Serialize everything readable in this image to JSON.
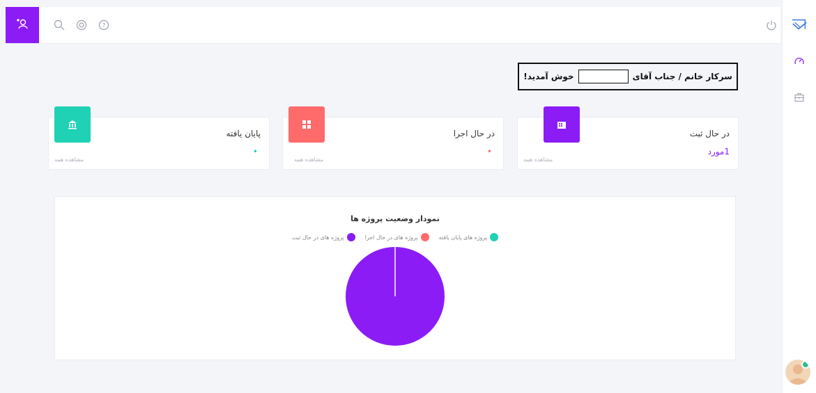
{
  "header": {
    "icons": [
      "add-user-icon",
      "search-icon",
      "support-icon",
      "help-icon",
      "power-icon"
    ]
  },
  "welcome": {
    "text": "سرکار خانم / جناب آقای",
    "suffix": "خوش آمدید!"
  },
  "cards": [
    {
      "title": "در حال ثبت",
      "value": "1مورد",
      "link": "مشاهده همه",
      "color": "#8b1cf6",
      "icon": "building-icon",
      "value_color": "#8b1cf6"
    },
    {
      "title": "در حال اجرا",
      "value": "•",
      "link": "مشاهده همه",
      "color": "#ff6b6b",
      "icon": "grid-icon",
      "value_color": "#ff6b6b"
    },
    {
      "title": "پایان یافته",
      "value": "•",
      "link": "مشاهده همه",
      "color": "#1fd1b5",
      "icon": "bank-icon",
      "value_color": "#1fd1b5"
    }
  ],
  "chart_data": {
    "type": "pie",
    "title": "نمودار وضعیت پروژه ها",
    "categories": [
      "پروژه های پایان یافته",
      "پروژه های در حال اجرا",
      "پروژه های در حال ثبت"
    ],
    "values": [
      0,
      0,
      1
    ],
    "colors": [
      "#1fd1b5",
      "#ff6b6b",
      "#8b1cf6"
    ],
    "legend": "top"
  }
}
